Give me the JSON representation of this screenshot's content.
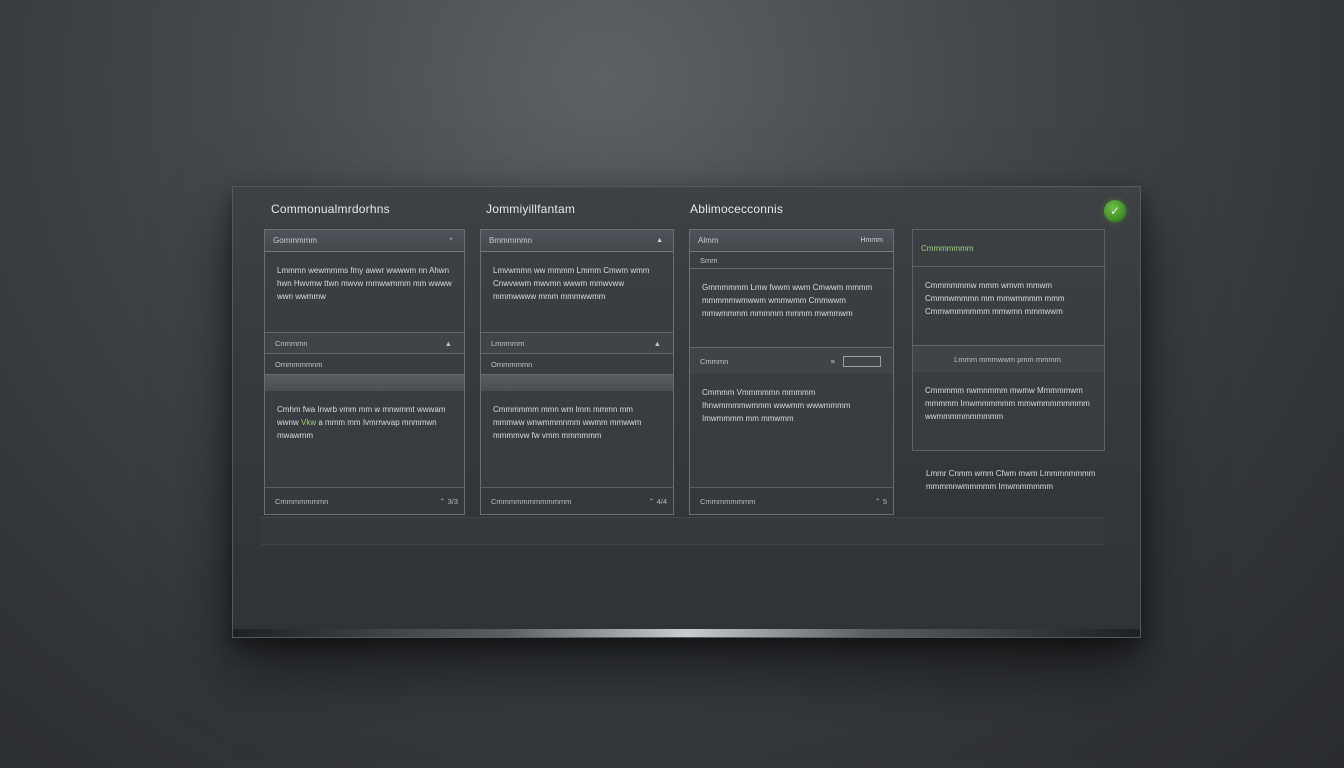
{
  "window": {
    "status_icon": "check-icon",
    "status_color": "#4aa52e"
  },
  "columns": [
    {
      "title": "Commonualmrdorhns",
      "header": "Gommmmm",
      "header_caret": "⌃",
      "paragraph": "Lmmmn wewmmms fmy awwr wwwwm nn Ahwn hwn Hwvmw ttwn mwvw rnmwwmmm mm wwww wwn wwmmw",
      "rows": [
        {
          "label": "Cnmmmn",
          "caret": "▲"
        },
        {
          "label": "Ommmmmnm",
          "caret": ""
        },
        {
          "label": "",
          "caret": ""
        }
      ],
      "paragraph2_prefix": "Cmhm fwa Inwrb vmm mm w mnwmmt wwwam wwnw",
      "paragraph2_highlight": "Vkw",
      "paragraph2_suffix": "a mmm mm Ivmrrwvap mnmmwn mwawmm",
      "footer": "Cmmmmmmmn",
      "footer_right": "⌃ 3/3"
    },
    {
      "title": "Jommiyillfantam",
      "header": "Bmmmmmn",
      "header_caret": "▲",
      "paragraph": "Lmvwmmn ww mmmm Lmmm Cmwm wmm Cnwvwwm mwvmn wwwm mmwvww mmmwwww mmm mmmwwmm",
      "rows": [
        {
          "label": "Lmnmmm",
          "caret": "▲"
        },
        {
          "label": "Ommmmmn",
          "caret": ""
        },
        {
          "label": "",
          "caret": ""
        }
      ],
      "paragraph2_prefix": "Cmmmmmm mmn wm lmm mmmn mm mmmww wnwmmmnmm wwmm mmwwm mmmmvw fw vmm mmmmmm",
      "paragraph2_highlight": "",
      "paragraph2_suffix": "",
      "footer": "Cmmmmmmmmmmmm",
      "footer_right": "⌃ 4/4"
    },
    {
      "title": "Ablimocecconnis",
      "header": "Almm",
      "header_caret": "Hmmm",
      "paragraph": "Gmmmmmm Lmw fwwm wwm Cmwwm mmmm mmmmmwmwwm wmmwmm Cmmwwm mmwmmmm mmmmm mmmm mwmmwm",
      "rows": [
        {
          "label": "Smm",
          "caret": ""
        },
        {
          "label": "Cmmmn",
          "caret": "≡"
        }
      ],
      "paragraph2_prefix": "Cmmmm Vmmmmmn mmmmm Ihnwmmmmwmmm wwwmm wwwmmmm Imwmmmm mm mmwmm",
      "paragraph2_highlight": "",
      "paragraph2_suffix": "",
      "footer": "Cmmmmmmmm",
      "footer_right": "⌃ 5"
    },
    {
      "title": "",
      "header": "Cmmmmmmm",
      "header_caret": "",
      "paragraph": "Cmmmmmmw mmm wmvm mmwm Cmmnwmmmn mm mmwmmmm mmm Cmmwmmmmmm mmwmn mmmwwm",
      "rows": [
        {
          "label": "Lmmm mmmwwm pmm mmmm",
          "caret": ""
        }
      ],
      "paragraph2_prefix": "Cmmmmm nwmnmmm mwmw Mmmmmwm mmmmm Imwmmmmmm mmwmmmmmmmm wwmmmmmmmmmm",
      "paragraph2_highlight": "",
      "paragraph2_suffix": "",
      "footer": "",
      "footer_right": "",
      "tail_paragraph": "Lmmr Cnmm wmm Cfwm mwm Lmmmnmmmm mmmmnwmmmmm Imwmmmmmm"
    }
  ]
}
